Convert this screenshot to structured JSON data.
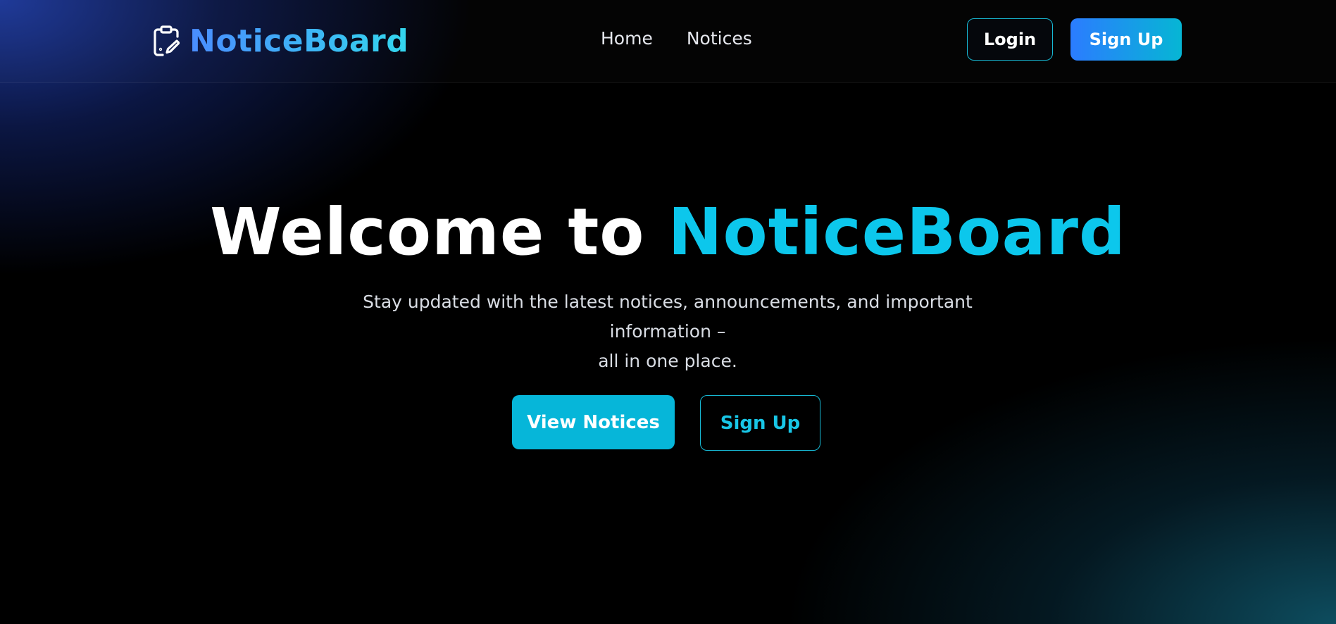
{
  "navbar": {
    "brand": {
      "icon": "clipboard-edit-icon",
      "name": "NoticeBoard"
    },
    "links": [
      {
        "label": "Home"
      },
      {
        "label": "Notices"
      }
    ],
    "login_label": "Login",
    "signup_label": "Sign Up"
  },
  "hero": {
    "title_prefix": "Welcome to ",
    "title_accent": "NoticeBoard",
    "subtitle_line1": "Stay updated with the latest notices, announcements, and important information –",
    "subtitle_line2": "all in one place.",
    "primary_button": "View Notices",
    "secondary_button": "Sign Up"
  },
  "colors": {
    "accent": "#0cc7ec",
    "brand_gradient_start": "#4a8dff",
    "brand_gradient_end": "#33d6ee",
    "background": "#000000"
  }
}
